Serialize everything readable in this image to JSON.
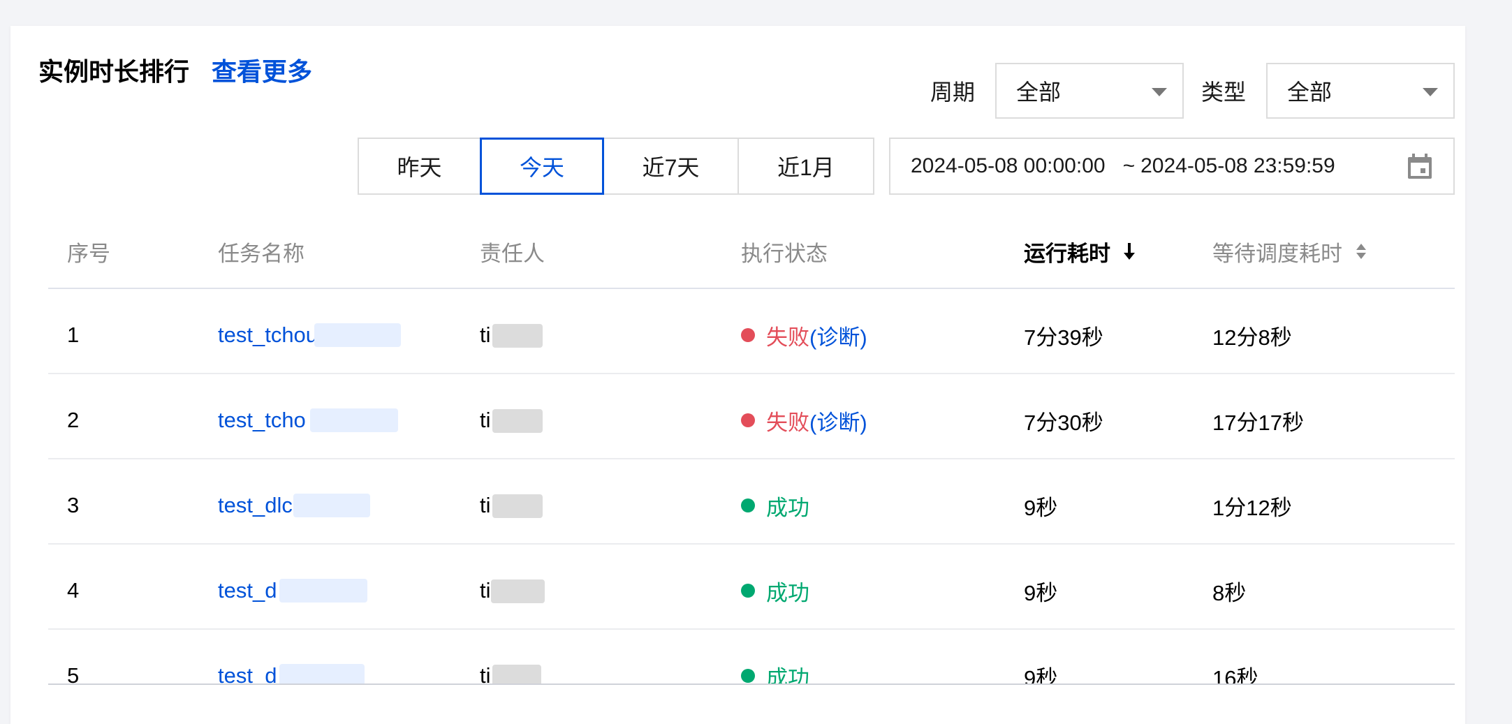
{
  "header": {
    "title": "实例时长排行",
    "more_link": "查看更多"
  },
  "filters": {
    "period_label": "周期",
    "period_value": "全部",
    "type_label": "类型",
    "type_value": "全部"
  },
  "quick_range": {
    "options": [
      "昨天",
      "今天",
      "近7天",
      "近1月"
    ],
    "active": "今天"
  },
  "date_range": {
    "start": "2024-05-08 00:00:00",
    "separator": "~",
    "end": "2024-05-08 23:59:59"
  },
  "table": {
    "columns": [
      "序号",
      "任务名称",
      "责任人",
      "执行状态",
      "运行耗时",
      "等待调度耗时"
    ],
    "sorted_column": "运行耗时",
    "sorted_direction": "desc",
    "rows": [
      {
        "index": "1",
        "task": "test_tchou",
        "owner": "ti",
        "status": "失败",
        "diag": "(诊断)",
        "status_kind": "fail",
        "run_time": "7分39秒",
        "wait_time": "12分8秒"
      },
      {
        "index": "2",
        "task": "test_tcho",
        "owner": "ti",
        "status": "失败",
        "diag": "(诊断)",
        "status_kind": "fail",
        "run_time": "7分30秒",
        "wait_time": "17分17秒"
      },
      {
        "index": "3",
        "task": "test_dlc",
        "owner": "ti",
        "status": "成功",
        "diag": "",
        "status_kind": "ok",
        "run_time": "9秒",
        "wait_time": "1分12秒"
      },
      {
        "index": "4",
        "task": "test_d",
        "owner": "ti",
        "status": "成功",
        "diag": "",
        "status_kind": "ok",
        "run_time": "9秒",
        "wait_time": "8秒"
      },
      {
        "index": "5",
        "task": "test_d",
        "owner": "ti",
        "status": "成功",
        "diag": "",
        "status_kind": "ok",
        "run_time": "9秒",
        "wait_time": "16秒"
      }
    ]
  },
  "colors": {
    "accent": "#0052d9",
    "fail": "#e34d59",
    "success": "#00a870"
  },
  "icons": {
    "select_arrow": "chevron-down-icon",
    "calendar": "calendar-icon",
    "sort_desc": "arrow-down-icon",
    "sort_both": "sort-icon"
  }
}
